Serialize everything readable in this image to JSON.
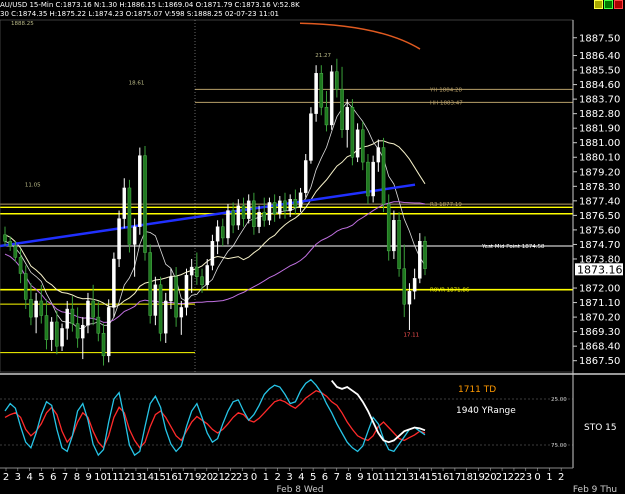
{
  "header": {
    "line1": "AU/USD 15-Min C:1873.16 N:1.30 H:1886.15 L:1869.04 O:1871.79 C:1873.16 V:52.8K",
    "line2": "30 C:1874.35 H:1875.22 L:1874.23 O:1875.07 V:598 S:1888.25 02-07-23 11:01"
  },
  "chart_data": [
    {
      "type": "candlestick",
      "ylim": [
        1866.8,
        1888.6
      ],
      "yticks": [
        "1887.50",
        "1886.40",
        "1885.50",
        "1884.60",
        "1883.70",
        "1882.80",
        "1881.90",
        "1881.00",
        "1880.10",
        "1879.20",
        "1878.30",
        "1877.40",
        "1876.50",
        "1875.60",
        "1874.70",
        "1873.80",
        "1872.00",
        "1871.10",
        "1870.20",
        "1869.30",
        "1868.40",
        "1867.50"
      ],
      "last_price": "1873.16",
      "candles": [
        [
          1875.3,
          1875.8,
          1874.6,
          1874.9
        ],
        [
          1874.9,
          1875.2,
          1874.3,
          1874.6
        ],
        [
          1874.6,
          1874.9,
          1873.6,
          1873.9
        ],
        [
          1873.9,
          1874.4,
          1872.3,
          1872.9
        ],
        [
          1872.9,
          1873.4,
          1870.7,
          1871.3
        ],
        [
          1871.3,
          1872.3,
          1869.7,
          1870.2
        ],
        [
          1870.2,
          1871.7,
          1869.2,
          1871.2
        ],
        [
          1871.2,
          1872.2,
          1869.8,
          1870.3
        ],
        [
          1870.3,
          1871.3,
          1868.2,
          1868.8
        ],
        [
          1868.8,
          1870.2,
          1868.1,
          1869.9
        ],
        [
          1869.9,
          1870.6,
          1867.9,
          1868.4
        ],
        [
          1868.4,
          1869.8,
          1868.1,
          1869.5
        ],
        [
          1869.5,
          1871.2,
          1868.8,
          1870.7
        ],
        [
          1870.7,
          1871.5,
          1869.3,
          1869.8
        ],
        [
          1869.8,
          1870.8,
          1868.3,
          1868.9
        ],
        [
          1868.9,
          1870.2,
          1867.6,
          1869.7
        ],
        [
          1869.7,
          1871.7,
          1869.2,
          1871.2
        ],
        [
          1871.2,
          1872.2,
          1869.7,
          1870.2
        ],
        [
          1870.2,
          1871.2,
          1868.7,
          1869.2
        ],
        [
          1869.2,
          1869.8,
          1867.2,
          1867.8
        ],
        [
          1867.8,
          1871.3,
          1867.4,
          1870.8
        ],
        [
          1870.8,
          1874.2,
          1870.2,
          1873.8
        ],
        [
          1873.8,
          1876.8,
          1873.3,
          1876.3
        ],
        [
          1876.3,
          1878.8,
          1875.7,
          1878.2
        ],
        [
          1878.2,
          1878.7,
          1874.2,
          1874.7
        ],
        [
          1874.7,
          1876.3,
          1872.7,
          1875.8
        ],
        [
          1875.8,
          1880.7,
          1875.3,
          1880.2
        ],
        [
          1880.2,
          1880.8,
          1873.7,
          1874.2
        ],
        [
          1874.2,
          1874.7,
          1869.8,
          1870.3
        ],
        [
          1870.3,
          1872.7,
          1869.7,
          1872.2
        ],
        [
          1872.2,
          1872.7,
          1868.7,
          1869.2
        ],
        [
          1869.2,
          1871.7,
          1868.6,
          1871.2
        ],
        [
          1871.2,
          1873.2,
          1870.7,
          1872.7
        ],
        [
          1872.7,
          1873.3,
          1869.6,
          1870.2
        ],
        [
          1870.2,
          1871.2,
          1869.1,
          1870.8
        ],
        [
          1870.8,
          1873.2,
          1870.3,
          1872.8
        ],
        [
          1872.8,
          1873.8,
          1871.7,
          1873.3
        ],
        [
          1873.3,
          1874.2,
          1872.2,
          1872.7
        ],
        [
          1872.7,
          1873.2,
          1871.7,
          1872.2
        ],
        [
          1872.2,
          1873.8,
          1871.9,
          1873.4
        ],
        [
          1873.4,
          1875.3,
          1873.1,
          1874.9
        ],
        [
          1874.9,
          1876.2,
          1874.1,
          1875.8
        ],
        [
          1875.8,
          1876.3,
          1874.6,
          1875.1
        ],
        [
          1875.1,
          1877.2,
          1874.7,
          1876.8
        ],
        [
          1876.8,
          1877.3,
          1875.4,
          1875.9
        ],
        [
          1875.9,
          1877.5,
          1875.6,
          1877.1
        ],
        [
          1877.1,
          1877.6,
          1875.8,
          1876.3
        ],
        [
          1876.3,
          1877.8,
          1876.0,
          1877.4
        ],
        [
          1877.4,
          1877.9,
          1875.3,
          1875.8
        ],
        [
          1875.8,
          1877.1,
          1875.4,
          1876.7
        ],
        [
          1876.7,
          1877.6,
          1875.8,
          1876.2
        ],
        [
          1876.2,
          1877.6,
          1875.9,
          1877.3
        ],
        [
          1877.3,
          1877.8,
          1876.1,
          1876.6
        ],
        [
          1876.6,
          1877.7,
          1876.3,
          1877.4
        ],
        [
          1877.4,
          1877.9,
          1876.3,
          1876.8
        ],
        [
          1876.8,
          1877.8,
          1876.4,
          1877.5
        ],
        [
          1877.5,
          1878.1,
          1876.6,
          1877.0
        ],
        [
          1877.0,
          1878.2,
          1876.7,
          1877.9
        ],
        [
          1877.9,
          1880.3,
          1877.6,
          1879.9
        ],
        [
          1879.9,
          1883.2,
          1879.7,
          1882.8
        ],
        [
          1882.8,
          1885.8,
          1882.3,
          1885.3
        ],
        [
          1885.3,
          1885.8,
          1882.7,
          1883.2
        ],
        [
          1883.2,
          1884.2,
          1881.7,
          1882.1
        ],
        [
          1882.1,
          1885.8,
          1881.8,
          1885.4
        ],
        [
          1885.4,
          1886.2,
          1883.8,
          1884.3
        ],
        [
          1884.3,
          1885.7,
          1881.3,
          1881.8
        ],
        [
          1881.8,
          1883.7,
          1880.7,
          1883.2
        ],
        [
          1883.2,
          1883.7,
          1879.6,
          1880.1
        ],
        [
          1880.1,
          1882.2,
          1879.8,
          1881.8
        ],
        [
          1881.8,
          1882.3,
          1879.3,
          1879.8
        ],
        [
          1879.8,
          1880.3,
          1877.2,
          1877.7
        ],
        [
          1877.7,
          1880.2,
          1877.3,
          1879.8
        ],
        [
          1879.8,
          1881.2,
          1879.2,
          1880.7
        ],
        [
          1880.7,
          1881.3,
          1876.7,
          1877.2
        ],
        [
          1877.2,
          1877.8,
          1873.7,
          1874.3
        ],
        [
          1874.3,
          1876.8,
          1873.8,
          1876.2
        ],
        [
          1876.2,
          1876.7,
          1872.7,
          1873.2
        ],
        [
          1873.2,
          1874.7,
          1870.2,
          1871.0
        ],
        [
          1871.0,
          1872.3,
          1869.4,
          1871.8
        ],
        [
          1871.8,
          1873.2,
          1871.3,
          1872.6
        ],
        [
          1872.6,
          1875.4,
          1872.3,
          1874.9
        ],
        [
          1874.9,
          1875.2,
          1872.8,
          1873.2
        ]
      ],
      "horizontal_levels": [
        {
          "label": "YH 1884.28",
          "value": 1884.3,
          "color": "#b8a06a"
        },
        {
          "label": "HH 1883.47",
          "value": 1883.5,
          "color": "#b8a06a"
        },
        {
          "label": "R3 1877.19",
          "value": 1877.2,
          "color": "#b8a06a"
        },
        {
          "label": "Yest Mid Point 1874.58",
          "value": 1874.6,
          "color": "#ffffff"
        },
        {
          "label": "R0VR 1871.86",
          "value": 1871.9,
          "color": "#ffff00"
        }
      ],
      "annotations": [
        {
          "text": "1888.25",
          "x_index": 0,
          "value": 1888.3
        },
        {
          "text": "21.27",
          "x_index": 61,
          "value": 1886.3
        },
        {
          "text": "18.61",
          "x_index": 25,
          "value": 1884.6
        },
        {
          "text": "11.05",
          "x_index": 5,
          "value": 1878.3
        },
        {
          "text": "17.11",
          "x_index": 78,
          "value": 1869.0
        }
      ]
    },
    {
      "type": "line",
      "ylim": [
        0,
        100
      ],
      "ytick_labels": [
        "25.00",
        "75.00"
      ],
      "labels": [
        "1711 TD",
        "1940 YRange",
        "STO 15"
      ],
      "series": [
        {
          "color": "#ff2a2a",
          "values": [
            55,
            58,
            60,
            55,
            42,
            35,
            40,
            48,
            60,
            66,
            58,
            40,
            28,
            35,
            50,
            60,
            55,
            40,
            28,
            22,
            35,
            55,
            66,
            60,
            42,
            30,
            22,
            28,
            45,
            58,
            62,
            55,
            45,
            35,
            30,
            40,
            50,
            56,
            52,
            48,
            42,
            38,
            42,
            48,
            55,
            60,
            58,
            52,
            50,
            54,
            60,
            66,
            72,
            74,
            72,
            68,
            65,
            70,
            76,
            80,
            84,
            82,
            78,
            72,
            68,
            60,
            50,
            42,
            35,
            32,
            30,
            35,
            45,
            50,
            44,
            38,
            32,
            30,
            33,
            36,
            40,
            38
          ]
        },
        {
          "color": "#26c4e6",
          "values": [
            62,
            70,
            65,
            45,
            28,
            22,
            38,
            58,
            72,
            68,
            42,
            22,
            18,
            35,
            62,
            70,
            52,
            26,
            14,
            20,
            50,
            75,
            82,
            55,
            25,
            14,
            18,
            45,
            70,
            78,
            66,
            42,
            26,
            18,
            24,
            45,
            62,
            70,
            55,
            38,
            28,
            32,
            48,
            62,
            72,
            74,
            62,
            52,
            58,
            68,
            80,
            86,
            90,
            88,
            80,
            70,
            72,
            84,
            92,
            96,
            90,
            82,
            70,
            60,
            48,
            38,
            28,
            22,
            18,
            24,
            40,
            55,
            48,
            32,
            20,
            18,
            26,
            34,
            42,
            44,
            40,
            36
          ]
        },
        {
          "color": "#ffffff",
          "values": [
            null,
            null,
            null,
            null,
            null,
            null,
            null,
            null,
            null,
            null,
            null,
            null,
            null,
            null,
            null,
            null,
            null,
            null,
            null,
            null,
            null,
            null,
            null,
            null,
            null,
            null,
            null,
            null,
            null,
            null,
            null,
            null,
            null,
            null,
            null,
            null,
            null,
            null,
            null,
            null,
            null,
            null,
            null,
            null,
            null,
            null,
            null,
            null,
            null,
            null,
            null,
            null,
            null,
            null,
            null,
            null,
            null,
            null,
            null,
            null,
            null,
            null,
            null,
            95,
            88,
            86,
            88,
            84,
            80,
            72,
            62,
            50,
            38,
            30,
            28,
            30,
            35,
            40,
            42,
            44,
            43,
            41
          ]
        }
      ],
      "x_tick_labels": [
        "2",
        "3",
        "4",
        "5",
        "6",
        "7",
        "8",
        "9",
        "10",
        "11",
        "12",
        "13",
        "14",
        "15",
        "16",
        "17",
        "19",
        "20",
        "21",
        "22",
        "23",
        "0",
        "1",
        "2",
        "3",
        "4",
        "5",
        "6",
        "7",
        "8",
        "9",
        "10",
        "11",
        "12",
        "13",
        "14",
        "15",
        "16",
        "17",
        "18",
        "19",
        "20",
        "21",
        "22",
        "23",
        "0",
        "1",
        "2"
      ],
      "date_labels": [
        "Feb 8 Wed",
        "Feb 9 Thu"
      ]
    }
  ]
}
